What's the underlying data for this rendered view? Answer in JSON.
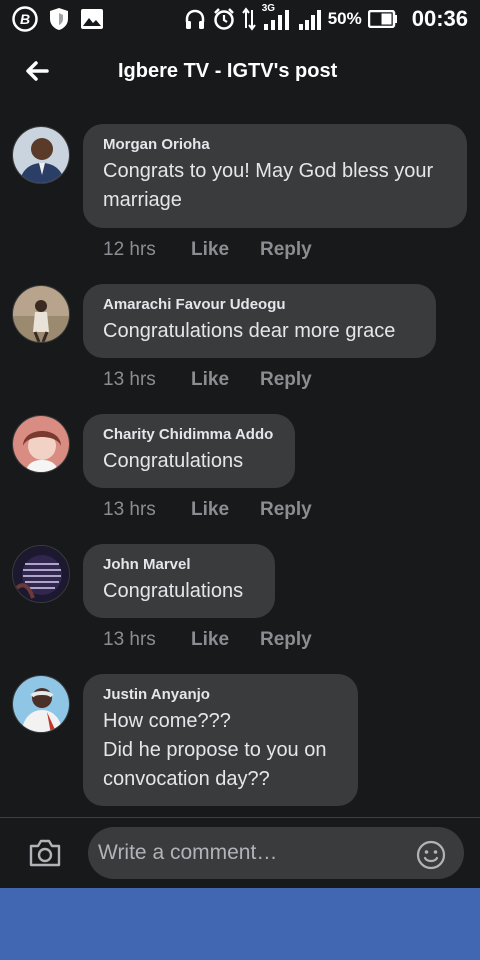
{
  "status_bar": {
    "battery_percent": "50%",
    "time": "00:36",
    "network_type": "3G",
    "icons": [
      "b-app-icon",
      "shield-icon",
      "image-icon",
      "headphones-icon",
      "alarm-clock-icon",
      "data-arrows-icon",
      "signal-icon",
      "signal-icon-2",
      "battery-icon"
    ]
  },
  "header": {
    "title": "Igbere TV - IGTV's post",
    "back_icon": "arrow-left-icon"
  },
  "comments": [
    {
      "author": "Morgan Orioha",
      "text": "Congrats to you! May God bless your\nmarriage",
      "time": "12 hrs",
      "like": "Like",
      "reply": "Reply"
    },
    {
      "author": "Amarachi Favour Udeogu",
      "text": "Congratulations dear more grace",
      "time": "13 hrs",
      "like": "Like",
      "reply": "Reply"
    },
    {
      "author": "Charity Chidimma Addo",
      "text": "Congratulations",
      "time": "13 hrs",
      "like": "Like",
      "reply": "Reply"
    },
    {
      "author": "John Marvel",
      "text": "Congratulations",
      "time": "13 hrs",
      "like": "Like",
      "reply": "Reply"
    },
    {
      "author": "Justin Anyanjo",
      "text": "How come???\nDid he propose to you on\nconvocation day??",
      "time": "",
      "like": "",
      "reply": ""
    }
  ],
  "composer": {
    "placeholder": "Write a comment…",
    "camera_icon": "camera-icon",
    "emoji_icon": "emoji-icon"
  },
  "colors": {
    "background": "#18191a",
    "bubble": "#3a3b3c",
    "text": "#e4e6eb",
    "muted": "#8a8d91",
    "nav_bar": "#4267b2"
  }
}
